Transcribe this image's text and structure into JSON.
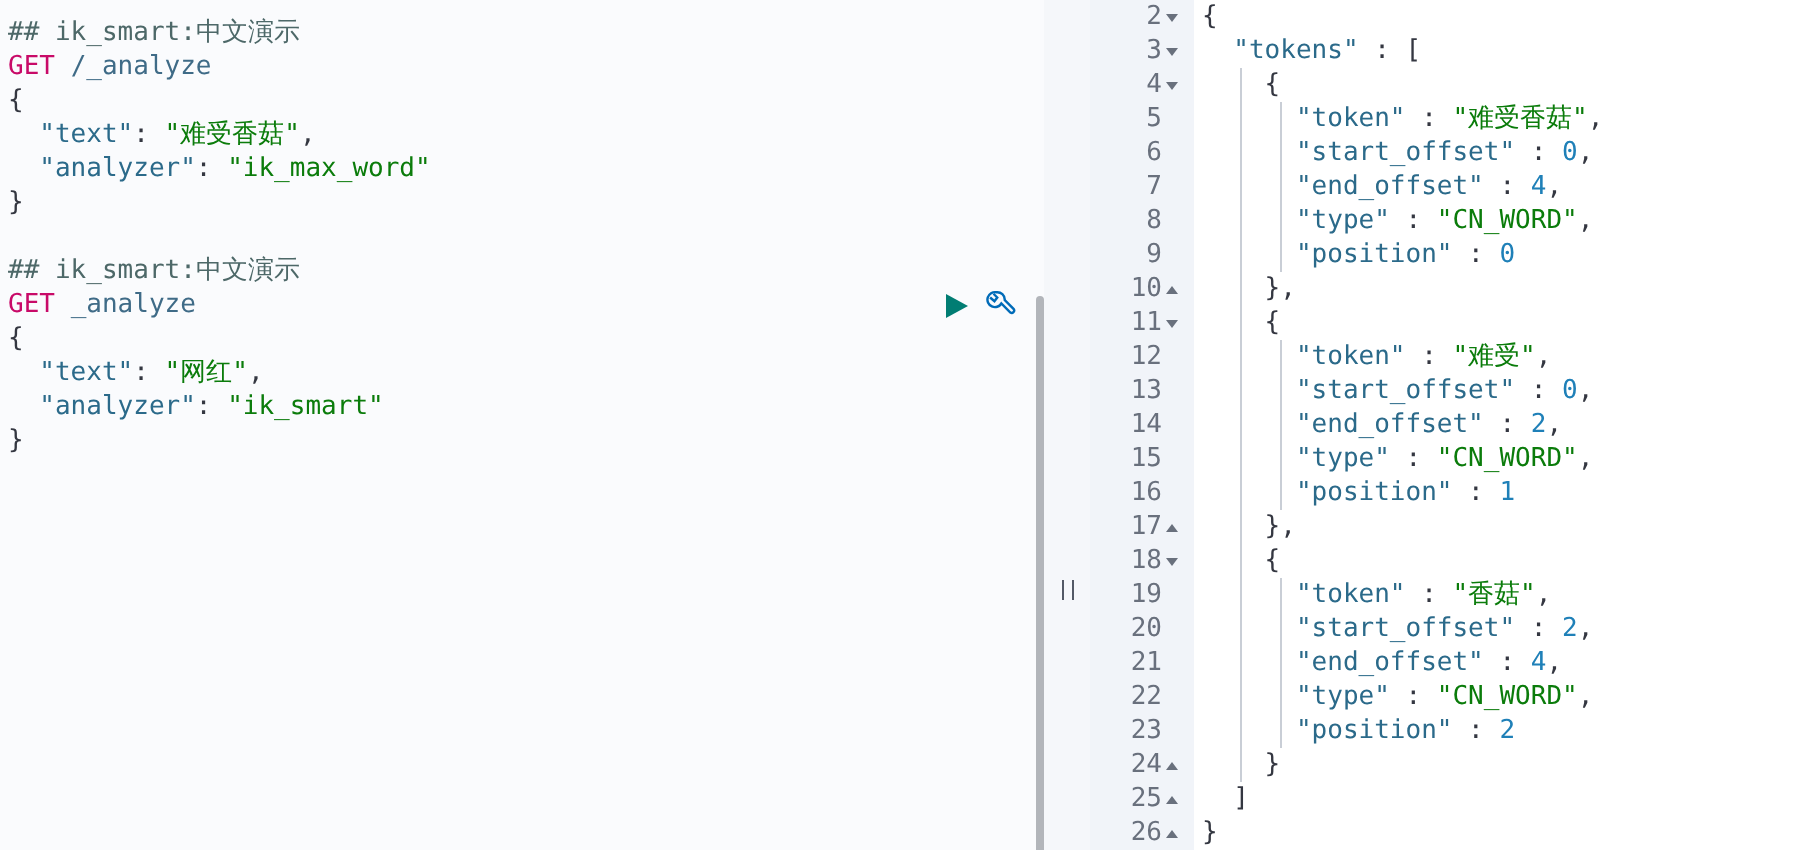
{
  "request_editor": {
    "requests": [
      {
        "active": false,
        "lines": [
          [
            {
              "kind": "comment",
              "text": "## ik_smart:中文演示"
            }
          ],
          [
            {
              "kind": "method",
              "text": "GET "
            },
            {
              "kind": "url",
              "text": "/_analyze"
            }
          ],
          [
            {
              "kind": "punct",
              "text": "{"
            }
          ],
          [
            {
              "kind": "key",
              "text": "  \"text\""
            },
            {
              "kind": "punct",
              "text": ": "
            },
            {
              "kind": "string",
              "text": "\"难受香菇\""
            },
            {
              "kind": "punct",
              "text": ","
            }
          ],
          [
            {
              "kind": "key",
              "text": "  \"analyzer\""
            },
            {
              "kind": "punct",
              "text": ": "
            },
            {
              "kind": "string",
              "text": "\"ik_max_word\""
            }
          ],
          [
            {
              "kind": "punct",
              "text": "}"
            }
          ]
        ]
      },
      {
        "active": true,
        "lines": [
          [
            {
              "kind": "comment",
              "text": "## ik_smart:中文演示"
            }
          ],
          [
            {
              "kind": "method",
              "text": "GET "
            },
            {
              "kind": "url",
              "text": "_analyze"
            }
          ],
          [
            {
              "kind": "punct",
              "text": "{"
            }
          ],
          [
            {
              "kind": "key",
              "text": "  \"text\""
            },
            {
              "kind": "punct",
              "text": ": "
            },
            {
              "kind": "string",
              "text": "\"网红\""
            },
            {
              "kind": "punct",
              "text": ","
            }
          ],
          [
            {
              "kind": "key",
              "text": "  \"analyzer\""
            },
            {
              "kind": "punct",
              "text": ": "
            },
            {
              "kind": "string",
              "text": "\"ik_smart\""
            }
          ],
          [
            {
              "kind": "punct",
              "text": "}"
            }
          ]
        ]
      }
    ]
  },
  "response_viewer": {
    "lines": [
      {
        "number": "2",
        "fold_start": true,
        "fold_end": false,
        "tokens": [
          {
            "kind": "punct",
            "text": "{"
          }
        ]
      },
      {
        "number": "3",
        "fold_start": true,
        "fold_end": false,
        "tokens": [
          {
            "kind": "key",
            "text": "  \"tokens\""
          },
          {
            "kind": "punct",
            "text": " : ["
          }
        ]
      },
      {
        "number": "4",
        "fold_start": true,
        "fold_end": false,
        "tokens": [
          {
            "kind": "punct",
            "text": "    {"
          }
        ]
      },
      {
        "number": "5",
        "fold_start": false,
        "fold_end": false,
        "tokens": [
          {
            "kind": "key",
            "text": "      \"token\""
          },
          {
            "kind": "punct",
            "text": " : "
          },
          {
            "kind": "string",
            "text": "\"难受香菇\""
          },
          {
            "kind": "punct",
            "text": ","
          }
        ]
      },
      {
        "number": "6",
        "fold_start": false,
        "fold_end": false,
        "tokens": [
          {
            "kind": "key",
            "text": "      \"start_offset\""
          },
          {
            "kind": "punct",
            "text": " : "
          },
          {
            "kind": "number",
            "text": "0"
          },
          {
            "kind": "punct",
            "text": ","
          }
        ]
      },
      {
        "number": "7",
        "fold_start": false,
        "fold_end": false,
        "tokens": [
          {
            "kind": "key",
            "text": "      \"end_offset\""
          },
          {
            "kind": "punct",
            "text": " : "
          },
          {
            "kind": "number",
            "text": "4"
          },
          {
            "kind": "punct",
            "text": ","
          }
        ]
      },
      {
        "number": "8",
        "fold_start": false,
        "fold_end": false,
        "tokens": [
          {
            "kind": "key",
            "text": "      \"type\""
          },
          {
            "kind": "punct",
            "text": " : "
          },
          {
            "kind": "string",
            "text": "\"CN_WORD\""
          },
          {
            "kind": "punct",
            "text": ","
          }
        ]
      },
      {
        "number": "9",
        "fold_start": false,
        "fold_end": false,
        "tokens": [
          {
            "kind": "key",
            "text": "      \"position\""
          },
          {
            "kind": "punct",
            "text": " : "
          },
          {
            "kind": "number",
            "text": "0"
          }
        ]
      },
      {
        "number": "10",
        "fold_start": false,
        "fold_end": true,
        "tokens": [
          {
            "kind": "punct",
            "text": "    },"
          }
        ]
      },
      {
        "number": "11",
        "fold_start": true,
        "fold_end": false,
        "tokens": [
          {
            "kind": "punct",
            "text": "    {"
          }
        ]
      },
      {
        "number": "12",
        "fold_start": false,
        "fold_end": false,
        "tokens": [
          {
            "kind": "key",
            "text": "      \"token\""
          },
          {
            "kind": "punct",
            "text": " : "
          },
          {
            "kind": "string",
            "text": "\"难受\""
          },
          {
            "kind": "punct",
            "text": ","
          }
        ]
      },
      {
        "number": "13",
        "fold_start": false,
        "fold_end": false,
        "tokens": [
          {
            "kind": "key",
            "text": "      \"start_offset\""
          },
          {
            "kind": "punct",
            "text": " : "
          },
          {
            "kind": "number",
            "text": "0"
          },
          {
            "kind": "punct",
            "text": ","
          }
        ]
      },
      {
        "number": "14",
        "fold_start": false,
        "fold_end": false,
        "tokens": [
          {
            "kind": "key",
            "text": "      \"end_offset\""
          },
          {
            "kind": "punct",
            "text": " : "
          },
          {
            "kind": "number",
            "text": "2"
          },
          {
            "kind": "punct",
            "text": ","
          }
        ]
      },
      {
        "number": "15",
        "fold_start": false,
        "fold_end": false,
        "tokens": [
          {
            "kind": "key",
            "text": "      \"type\""
          },
          {
            "kind": "punct",
            "text": " : "
          },
          {
            "kind": "string",
            "text": "\"CN_WORD\""
          },
          {
            "kind": "punct",
            "text": ","
          }
        ]
      },
      {
        "number": "16",
        "fold_start": false,
        "fold_end": false,
        "tokens": [
          {
            "kind": "key",
            "text": "      \"position\""
          },
          {
            "kind": "punct",
            "text": " : "
          },
          {
            "kind": "number",
            "text": "1"
          }
        ]
      },
      {
        "number": "17",
        "fold_start": false,
        "fold_end": true,
        "tokens": [
          {
            "kind": "punct",
            "text": "    },"
          }
        ]
      },
      {
        "number": "18",
        "fold_start": true,
        "fold_end": false,
        "tokens": [
          {
            "kind": "punct",
            "text": "    {"
          }
        ]
      },
      {
        "number": "19",
        "fold_start": false,
        "fold_end": false,
        "tokens": [
          {
            "kind": "key",
            "text": "      \"token\""
          },
          {
            "kind": "punct",
            "text": " : "
          },
          {
            "kind": "string",
            "text": "\"香菇\""
          },
          {
            "kind": "punct",
            "text": ","
          }
        ]
      },
      {
        "number": "20",
        "fold_start": false,
        "fold_end": false,
        "tokens": [
          {
            "kind": "key",
            "text": "      \"start_offset\""
          },
          {
            "kind": "punct",
            "text": " : "
          },
          {
            "kind": "number",
            "text": "2"
          },
          {
            "kind": "punct",
            "text": ","
          }
        ]
      },
      {
        "number": "21",
        "fold_start": false,
        "fold_end": false,
        "tokens": [
          {
            "kind": "key",
            "text": "      \"end_offset\""
          },
          {
            "kind": "punct",
            "text": " : "
          },
          {
            "kind": "number",
            "text": "4"
          },
          {
            "kind": "punct",
            "text": ","
          }
        ]
      },
      {
        "number": "22",
        "fold_start": false,
        "fold_end": false,
        "tokens": [
          {
            "kind": "key",
            "text": "      \"type\""
          },
          {
            "kind": "punct",
            "text": " : "
          },
          {
            "kind": "string",
            "text": "\"CN_WORD\""
          },
          {
            "kind": "punct",
            "text": ","
          }
        ]
      },
      {
        "number": "23",
        "fold_start": false,
        "fold_end": false,
        "tokens": [
          {
            "kind": "key",
            "text": "      \"position\""
          },
          {
            "kind": "punct",
            "text": " : "
          },
          {
            "kind": "number",
            "text": "2"
          }
        ]
      },
      {
        "number": "24",
        "fold_start": false,
        "fold_end": true,
        "tokens": [
          {
            "kind": "punct",
            "text": "    }"
          }
        ]
      },
      {
        "number": "25",
        "fold_start": false,
        "fold_end": true,
        "tokens": [
          {
            "kind": "punct",
            "text": "  ]"
          }
        ]
      },
      {
        "number": "26",
        "fold_start": false,
        "fold_end": true,
        "tokens": [
          {
            "kind": "punct",
            "text": "}"
          }
        ]
      }
    ]
  }
}
